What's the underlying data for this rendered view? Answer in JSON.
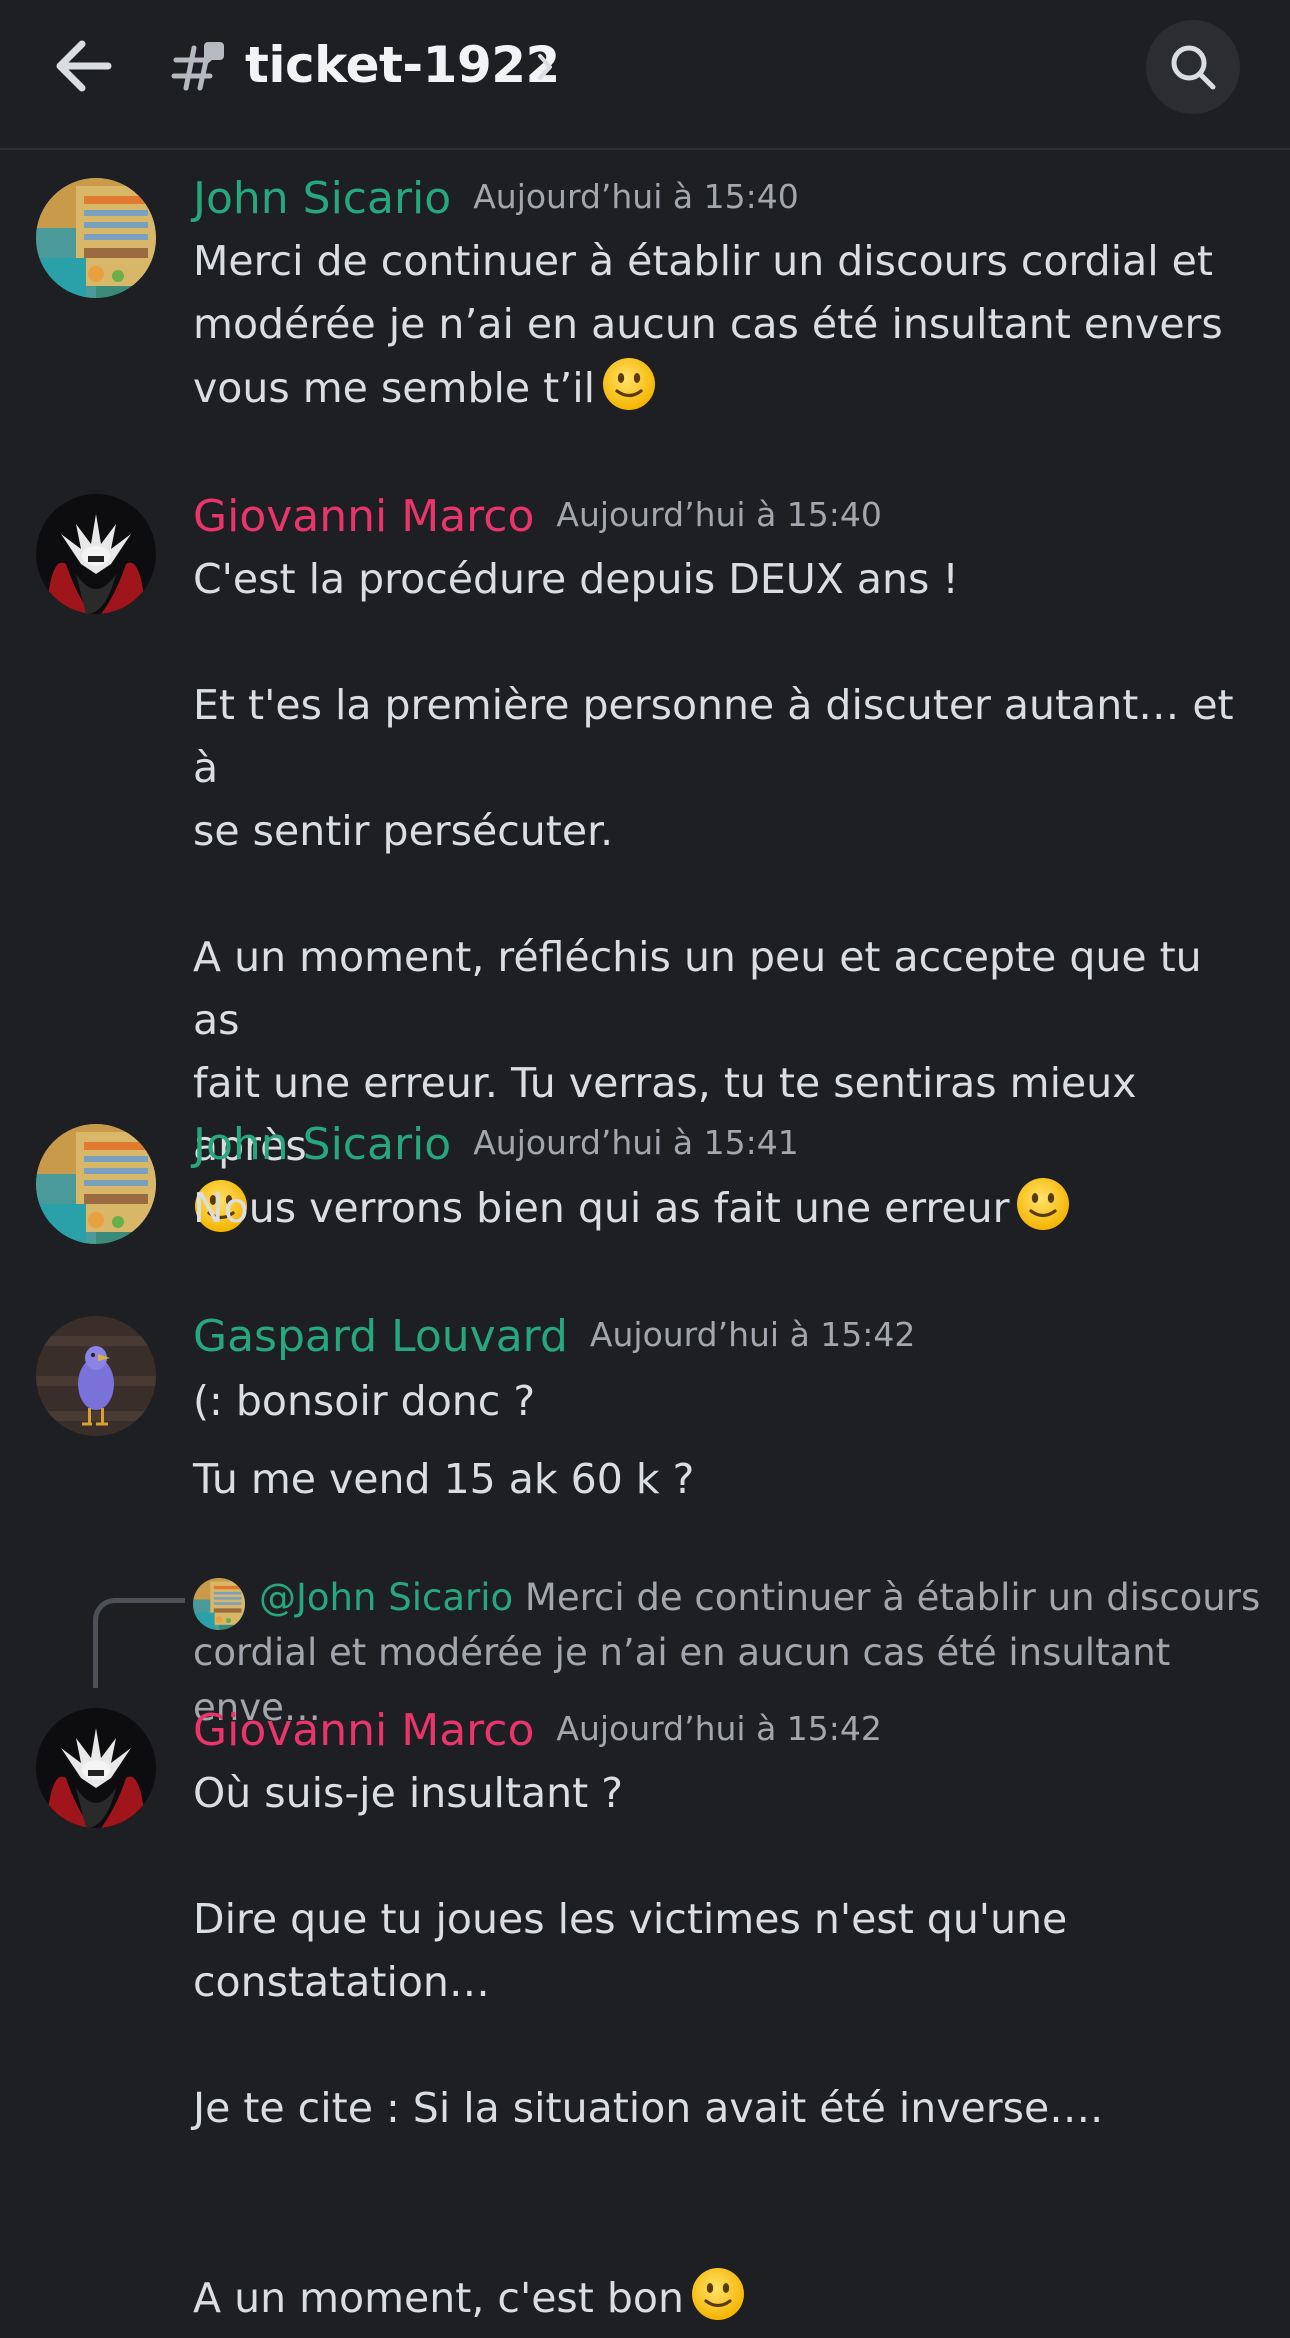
{
  "header": {
    "channel_name": "ticket-1922",
    "back_icon": "arrow-left-icon",
    "channel_icon": "thread-hash-icon",
    "chevron_icon": "chevron-right-icon",
    "search_icon": "search-icon"
  },
  "colors": {
    "background": "#1e1f22",
    "john": "#26a77c",
    "giovanni": "#e9356b",
    "gaspard": "#26a77c",
    "timestamp": "#a3a6ad"
  },
  "messages": [
    {
      "author": "John Sicario",
      "time": "Aujourd’hui à 15:40",
      "lines": [
        "Merci de continuer à établir un discours cordial et",
        "modérée je n’ai en aucun cas été insultant envers",
        "vous me semble t’il"
      ]
    },
    {
      "author": "Giovanni Marco",
      "time": "Aujourd’hui à 15:40",
      "lines": [
        "C'est la procédure depuis DEUX ans !",
        "",
        "Et t'es la première personne à discuter autant… et à",
        "se sentir persécuter.",
        "",
        "A un moment, réfléchis un peu et accepte que tu as",
        "fait une erreur. Tu verras, tu te sentiras mieux après"
      ]
    },
    {
      "author": "John Sicario",
      "time": "Aujourd’hui à 15:41",
      "lines": [
        "Nous verrons bien qui as fait une erreur"
      ]
    },
    {
      "author": "Gaspard Louvard",
      "time": "Aujourd’hui à 15:42",
      "lines": [
        "(: bonsoir donc ?",
        "Tu me vend 15 ak 60 k ?"
      ]
    },
    {
      "reply": {
        "mention": "@John Sicario",
        "preview": "Merci de continuer à établir un discours cordial et modérée je n’ai en aucun cas été insultant enve…"
      },
      "author": "Giovanni Marco",
      "time": "Aujourd’hui à 15:42",
      "lines": [
        "Où suis-je insultant ?",
        "",
        "Dire que tu joues les victimes n'est qu'une",
        "constatation…",
        "",
        "Je te cite : Si la situation avait été inverse…."
      ],
      "last_line": "A un moment, c'est bon"
    }
  ]
}
